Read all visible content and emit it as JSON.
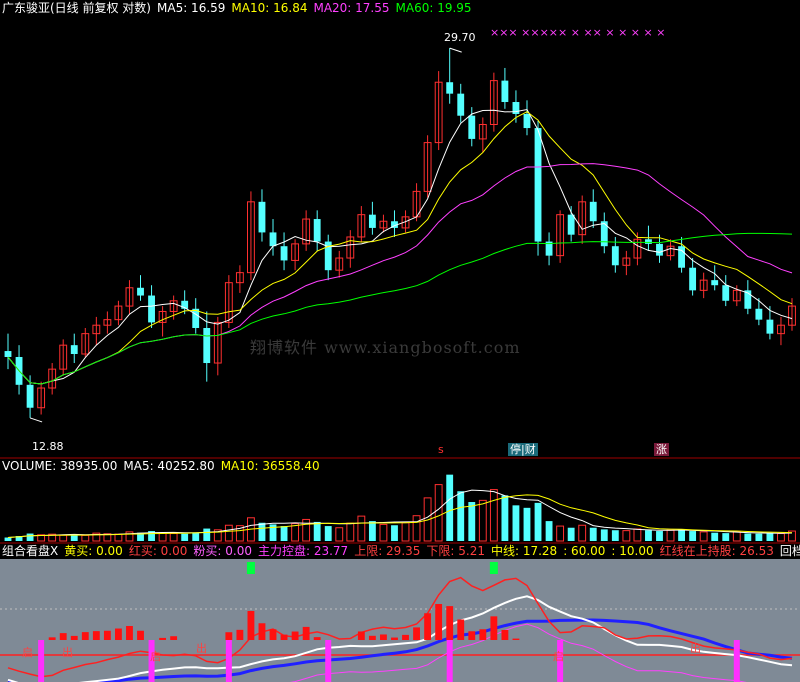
{
  "header": {
    "stock": "广东骏亚(日线 前复权 对数)",
    "ma5": "MA5: 16.59",
    "ma10": "MA10: 16.84",
    "ma20": "MA20: 17.55",
    "ma60": "MA60: 19.95"
  },
  "volume_header": {
    "volume": "VOLUME: 38935.00",
    "ma5": "MA5: 40252.80",
    "ma10": "MA10: 36558.40"
  },
  "indicator_header": {
    "name": "组合看盘X",
    "yellow_buy": "黄买: 0.00",
    "red_buy": "红买: 0.00",
    "pink_buy": "粉买: 0.00",
    "main_control": "主力控盘: 23.77",
    "upper": "上限: 29.35",
    "lower": "下限: 5.21",
    "middle": "中线: 17.28",
    "sixty": ": 60.00",
    "ten": ": 10.00",
    "red_line_hold": "红线在上持股: 26.53",
    "pullback": "回档不"
  },
  "annotations": {
    "high": "29.70",
    "low": "12.88",
    "watermark": "翔博软件 www.xiangbosoft.com",
    "tag_s": "s",
    "tag_suspend": "停|财",
    "tag_rise": "涨",
    "x_marks": "×××  ××××× ×   ××  ×    × × × ×",
    "ind_labels": [
      "启",
      "出",
      "启",
      "出",
      "启",
      "出"
    ]
  },
  "colors": {
    "up": "#ff3030",
    "down": "#54ffff",
    "ma5": "#ffffff",
    "ma10": "#ffff00",
    "ma20": "#ff40ff",
    "ma60": "#00ff00",
    "label_cyan": "#ffffff"
  },
  "chart_data": {
    "type": "candlestick",
    "y_scale": "log",
    "ylim": [
      12.0,
      31.5
    ],
    "high_label": 29.7,
    "low_label": 12.88,
    "candles": [
      [
        15.0,
        15.6,
        14.4,
        14.8
      ],
      [
        14.8,
        15.2,
        13.6,
        13.9
      ],
      [
        13.9,
        14.2,
        12.9,
        13.2
      ],
      [
        13.2,
        14.0,
        13.0,
        13.8
      ],
      [
        13.8,
        14.6,
        13.6,
        14.4
      ],
      [
        14.4,
        15.4,
        14.2,
        15.2
      ],
      [
        15.2,
        15.6,
        14.6,
        14.9
      ],
      [
        14.9,
        15.8,
        14.8,
        15.6
      ],
      [
        15.6,
        16.2,
        15.2,
        15.9
      ],
      [
        15.9,
        16.4,
        15.6,
        16.1
      ],
      [
        16.1,
        16.8,
        15.9,
        16.6
      ],
      [
        16.6,
        17.6,
        16.3,
        17.3
      ],
      [
        17.3,
        17.8,
        16.8,
        17.0
      ],
      [
        17.0,
        17.4,
        15.8,
        16.0
      ],
      [
        16.0,
        16.6,
        15.5,
        16.4
      ],
      [
        16.4,
        17.0,
        16.1,
        16.8
      ],
      [
        16.8,
        17.2,
        16.3,
        16.5
      ],
      [
        16.5,
        16.9,
        15.6,
        15.8
      ],
      [
        15.8,
        16.4,
        14.0,
        14.6
      ],
      [
        14.6,
        16.2,
        14.2,
        16.0
      ],
      [
        16.0,
        17.8,
        15.8,
        17.5
      ],
      [
        17.5,
        18.2,
        17.1,
        17.9
      ],
      [
        17.9,
        21.5,
        17.6,
        21.0
      ],
      [
        21.0,
        21.6,
        19.2,
        19.6
      ],
      [
        19.6,
        20.2,
        18.6,
        19.0
      ],
      [
        19.0,
        19.6,
        18.0,
        18.4
      ],
      [
        18.4,
        19.3,
        18.0,
        19.1
      ],
      [
        19.1,
        20.6,
        18.8,
        20.2
      ],
      [
        20.2,
        20.6,
        18.8,
        19.2
      ],
      [
        19.2,
        19.5,
        17.6,
        18.0
      ],
      [
        18.0,
        18.8,
        17.7,
        18.5
      ],
      [
        18.5,
        19.7,
        18.1,
        19.4
      ],
      [
        19.4,
        20.8,
        19.2,
        20.4
      ],
      [
        20.4,
        21.0,
        19.5,
        19.8
      ],
      [
        19.8,
        20.4,
        19.6,
        20.1
      ],
      [
        20.1,
        20.6,
        19.4,
        19.8
      ],
      [
        19.8,
        20.6,
        19.6,
        20.3
      ],
      [
        20.3,
        21.9,
        20.1,
        21.5
      ],
      [
        21.5,
        24.4,
        21.2,
        24.0
      ],
      [
        24.0,
        28.2,
        23.6,
        27.5
      ],
      [
        27.5,
        29.7,
        26.2,
        26.8
      ],
      [
        26.8,
        27.4,
        25.1,
        25.5
      ],
      [
        25.5,
        26.0,
        23.8,
        24.2
      ],
      [
        24.2,
        25.4,
        23.5,
        25.0
      ],
      [
        25.0,
        28.1,
        24.6,
        27.6
      ],
      [
        27.6,
        28.4,
        25.9,
        26.3
      ],
      [
        26.3,
        27.0,
        25.1,
        25.6
      ],
      [
        25.6,
        26.4,
        24.4,
        24.8
      ],
      [
        24.8,
        25.2,
        18.6,
        19.2
      ],
      [
        19.2,
        19.6,
        18.2,
        18.6
      ],
      [
        18.6,
        20.6,
        18.3,
        20.4
      ],
      [
        20.4,
        20.8,
        19.2,
        19.5
      ],
      [
        19.5,
        21.3,
        19.1,
        21.0
      ],
      [
        21.0,
        21.6,
        19.8,
        20.1
      ],
      [
        20.1,
        20.5,
        18.7,
        19.0
      ],
      [
        19.0,
        19.4,
        17.9,
        18.2
      ],
      [
        18.2,
        18.8,
        17.8,
        18.5
      ],
      [
        18.5,
        19.6,
        18.2,
        19.3
      ],
      [
        19.3,
        19.9,
        18.8,
        19.1
      ],
      [
        19.1,
        19.5,
        18.3,
        18.6
      ],
      [
        18.6,
        19.3,
        18.4,
        19.0
      ],
      [
        19.0,
        19.4,
        17.9,
        18.1
      ],
      [
        18.1,
        18.5,
        17.0,
        17.2
      ],
      [
        17.2,
        17.9,
        16.9,
        17.6
      ],
      [
        17.6,
        18.2,
        17.2,
        17.4
      ],
      [
        17.4,
        17.8,
        16.6,
        16.8
      ],
      [
        16.8,
        17.4,
        16.6,
        17.2
      ],
      [
        17.2,
        17.6,
        16.3,
        16.5
      ],
      [
        16.5,
        16.9,
        15.9,
        16.1
      ],
      [
        16.1,
        16.6,
        15.4,
        15.6
      ],
      [
        15.6,
        16.2,
        15.2,
        15.9
      ],
      [
        15.9,
        16.9,
        15.7,
        16.6
      ]
    ],
    "volume_ylim": [
      0,
      82000
    ],
    "volume": [
      4200,
      6000,
      9000,
      7500,
      8200,
      7000,
      7800,
      6800,
      9500,
      8700,
      8300,
      11000,
      10000,
      12000,
      9800,
      9000,
      8800,
      10200,
      15000,
      13500,
      19000,
      18500,
      28000,
      22000,
      20000,
      18000,
      21000,
      26000,
      23000,
      18000,
      16000,
      21500,
      30000,
      24000,
      20000,
      19000,
      22000,
      30500,
      52000,
      68000,
      80000,
      60000,
      47000,
      49000,
      62000,
      55000,
      43000,
      40000,
      46000,
      24000,
      18000,
      16000,
      19000,
      16000,
      14000,
      13000,
      12500,
      14500,
      13000,
      12000,
      13000,
      14000,
      12000,
      11000,
      10000,
      9500,
      11000,
      9000,
      8800,
      9500,
      9000,
      12000
    ]
  }
}
